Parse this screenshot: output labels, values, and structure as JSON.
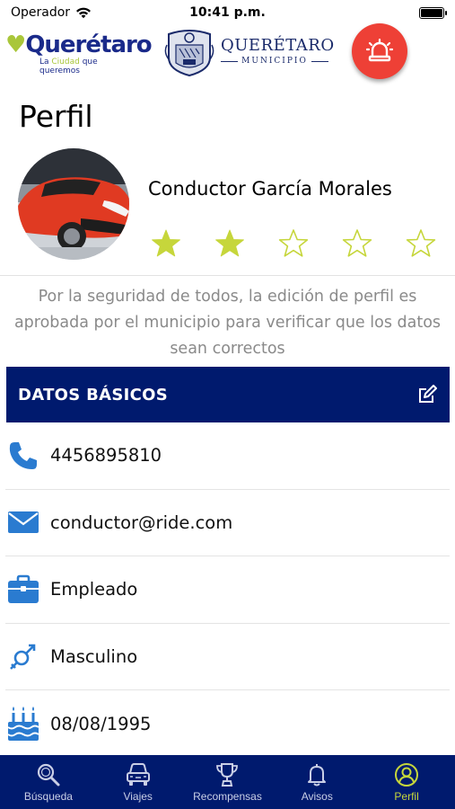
{
  "status_bar": {
    "carrier": "Operador",
    "time": "10:41 p.m."
  },
  "header": {
    "city_logo_text": "Querétaro",
    "city_logo_tagline_pre": "La ",
    "city_logo_tagline_hl": "Ciudad",
    "city_logo_tagline_post": " que queremos",
    "muni_logo_title": "QUERÉTARO",
    "muni_logo_sub": "MUNICIPIO"
  },
  "profile": {
    "page_title": "Perfil",
    "driver_name": "Conductor García Morales",
    "rating": 2,
    "rating_max": 5,
    "notice": "Por la seguridad de todos, la edición de perfil es aprobada por el municipio para verificar que los datos sean correctos"
  },
  "section": {
    "title": "DATOS BÁSICOS"
  },
  "info": {
    "phone": "4456895810",
    "email": "conductor@ride.com",
    "occupation": "Empleado",
    "gender": "Masculino",
    "birthdate": "08/08/1995"
  },
  "tabs": [
    {
      "label": "Búsqueda",
      "icon": "search-icon"
    },
    {
      "label": "Viajes",
      "icon": "car-icon"
    },
    {
      "label": "Recompensas",
      "icon": "trophy-icon"
    },
    {
      "label": "Avisos",
      "icon": "bell-icon"
    },
    {
      "label": "Perfil",
      "icon": "user-icon"
    }
  ],
  "colors": {
    "primary": "#001a6e",
    "accent": "#c6d63b",
    "alert": "#ee4036",
    "info_icon": "#2a7bd0"
  }
}
